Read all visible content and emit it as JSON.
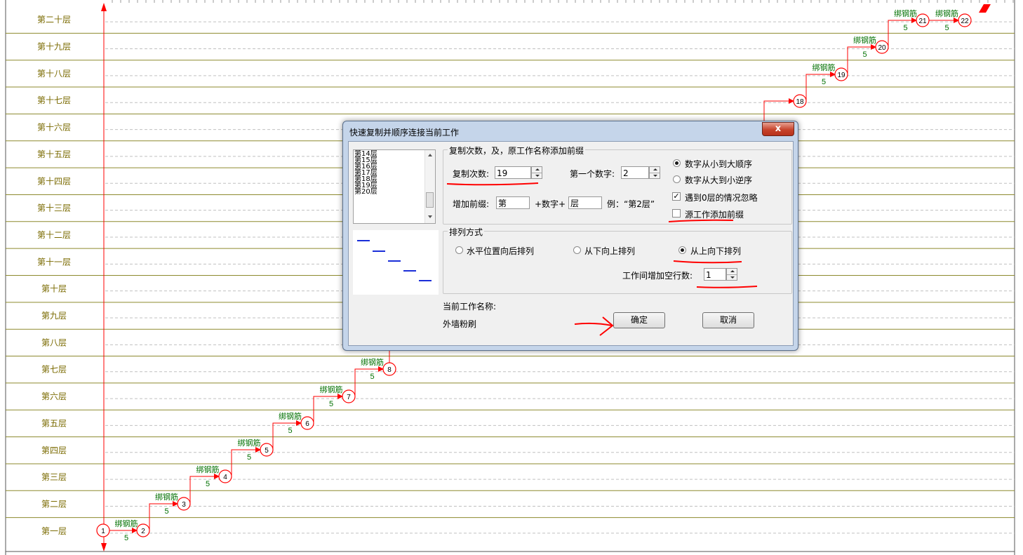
{
  "floors": [
    "第一层",
    "第二层",
    "第三层",
    "第四层",
    "第五层",
    "第六层",
    "第七层",
    "第八层",
    "第九层",
    "第十层",
    "第十一层",
    "第十二层",
    "第十三层",
    "第十四层",
    "第十五层",
    "第十六层",
    "第十七层",
    "第十八层",
    "第十九层",
    "第二十层"
  ],
  "network": {
    "nodes": [
      "1",
      "2",
      "3",
      "4",
      "5",
      "6",
      "7",
      "8",
      "18",
      "19",
      "20",
      "21",
      "22"
    ],
    "activity_labels": [
      "绑钢筋",
      "绑钢筋",
      "绑钢筋",
      "绑钢筋",
      "绑钢筋",
      "绑钢筋",
      "绑钢筋",
      "绑钢筋",
      "绑钢筋",
      "绑钢筋",
      "绑钢筋",
      "外墙粉刷"
    ],
    "duration": "5"
  },
  "dialog": {
    "title": "快速复制并顺序连接当前工作",
    "close_label": "x",
    "list_items": [
      "第14层",
      "第15层",
      "第16层",
      "第17层",
      "第18层",
      "第19层",
      "第20层"
    ],
    "copy_group_title": "复制次数，及，原工作名称添加前缀",
    "copy_count_label": "复制次数:",
    "copy_count_value": "19",
    "first_number_label": "第一个数字:",
    "first_number_value": "2",
    "prefix_label": "增加前缀:",
    "prefix_value": "第",
    "plus_number_label": "+数字+",
    "suffix_value": "层",
    "example_label": "例：“第2层”",
    "radio_asc_label": "数字从小到大顺序",
    "radio_desc_label": "数字从大到小逆序",
    "check_skip_zero_label": "遇到0层的情况忽略",
    "check_source_prefix_label": "源工作添加前缀",
    "arrange_group_title": "排列方式",
    "arrange_horizontal_label": "水平位置向后排列",
    "arrange_bottom_up_label": "从下向上排列",
    "arrange_top_down_label": "从上向下排列",
    "blank_rows_label": "工作间增加空行数:",
    "blank_rows_value": "1",
    "current_work_label": "当前工作名称:",
    "current_work_value": "外墙粉刷",
    "ok_label": "确定",
    "cancel_label": "取消"
  },
  "colors": {
    "floor_text": "#7a6a00",
    "row_line": "#8d8a2e",
    "network": "#ff0000",
    "activity_text": "#007000",
    "annotation": "#ff0000"
  }
}
